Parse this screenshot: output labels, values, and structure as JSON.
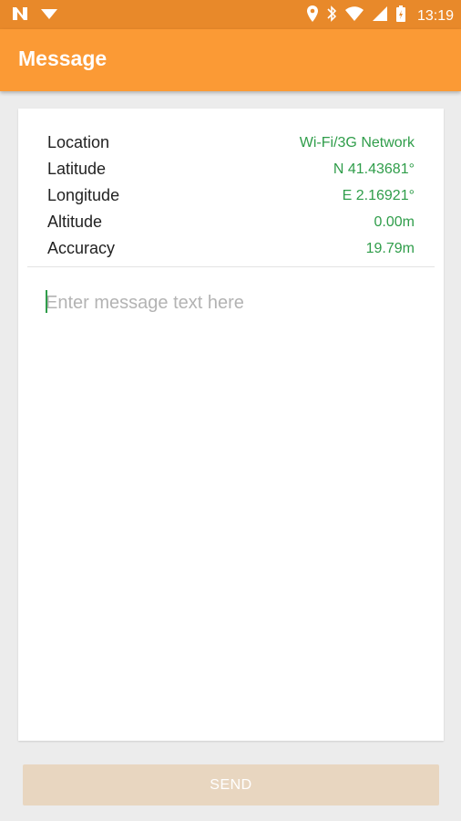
{
  "status_bar": {
    "time": "13:19",
    "icons": [
      "n-notification-icon",
      "download-icon",
      "location-pin-icon",
      "bluetooth-icon",
      "wifi-icon",
      "signal-icon",
      "battery-icon"
    ]
  },
  "app_bar": {
    "title": "Message"
  },
  "location_info": {
    "rows": [
      {
        "label": "Location",
        "value": "Wi-Fi/3G Network"
      },
      {
        "label": "Latitude",
        "value": "N 41.43681°"
      },
      {
        "label": "Longitude",
        "value": "E 2.16921°"
      },
      {
        "label": "Altitude",
        "value": "0.00m"
      },
      {
        "label": "Accuracy",
        "value": "19.79m"
      }
    ]
  },
  "message": {
    "placeholder": "Enter message text here",
    "value": ""
  },
  "send_button": {
    "label": "SEND"
  },
  "colors": {
    "status_bar": "#e8892a",
    "app_bar": "#fb9a35",
    "value_green": "#2f9d4a",
    "send_disabled": "#e8d6c0",
    "background": "#ececec"
  }
}
